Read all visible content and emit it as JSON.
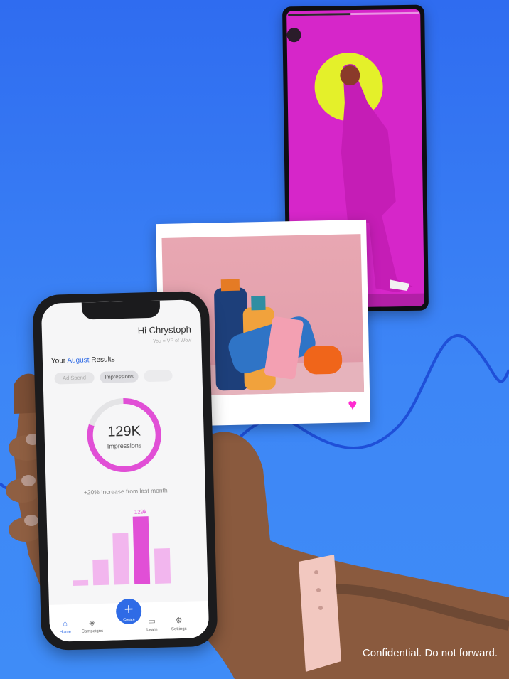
{
  "phone": {
    "greeting": "Hi Chrystoph",
    "role": "You = VP of Wow",
    "results_prefix": "Your",
    "results_month": "August",
    "results_suffix": "Results",
    "pills": [
      "Ad Spend",
      "Impressions"
    ],
    "metric_value": "129K",
    "metric_label": "Impressions",
    "increase_text": "+20% Increase from last month",
    "bar_peak_label": "129k",
    "nav": {
      "home": "Home",
      "campaigns": "Campaigns",
      "create": "Create",
      "learn": "Learn",
      "settings": "Settings"
    }
  },
  "donut_progress": 0.8,
  "bars": [
    0.08,
    0.38,
    0.76,
    1.0,
    0.52
  ],
  "footer": "Confidential. Do not forward.",
  "colors": {
    "accent": "#2f6be6",
    "pink": "#e14fd6",
    "heart": "#ff2bd0",
    "story_bg": "#d626c9"
  }
}
